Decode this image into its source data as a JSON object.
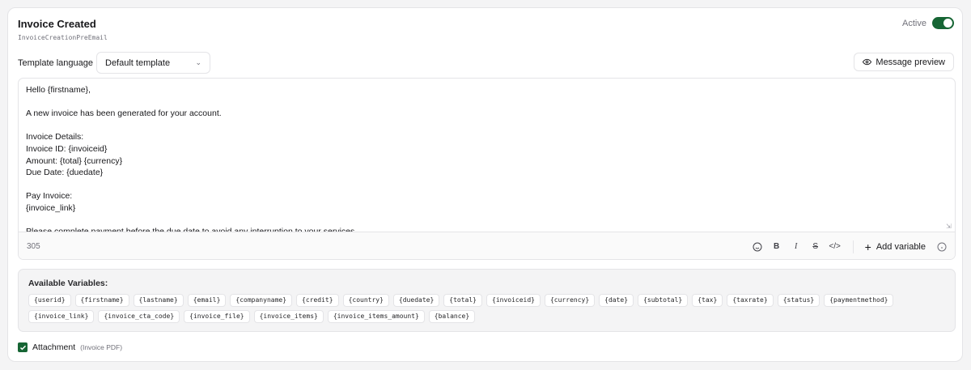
{
  "header": {
    "title": "Invoice Created",
    "template_key": "InvoiceCreationPreEmail",
    "active_label": "Active",
    "active": true
  },
  "template_language": {
    "label": "Template language",
    "selected": "Default template"
  },
  "preview_button": {
    "label": "Message preview",
    "icon": "eye-icon"
  },
  "editor": {
    "body": "Hello {firstname},\n\nA new invoice has been generated for your account.\n\nInvoice Details:\nInvoice ID: {invoiceid}\nAmount: {total} {currency}\nDue Date: {duedate}\n\nPay Invoice:\n{invoice_link}\n\nPlease complete payment before the due date to avoid any interruption to your services.",
    "char_count": "305",
    "tools": {
      "emoji": "smile-icon",
      "bold": "B",
      "italic": "I",
      "strike": "S",
      "code": "</>"
    },
    "add_variable_label": "Add variable"
  },
  "variables": {
    "title": "Available Variables:",
    "items": [
      "{userid}",
      "{firstname}",
      "{lastname}",
      "{email}",
      "{companyname}",
      "{credit}",
      "{country}",
      "{duedate}",
      "{total}",
      "{invoiceid}",
      "{currency}",
      "{date}",
      "{subtotal}",
      "{tax}",
      "{taxrate}",
      "{status}",
      "{paymentmethod}",
      "{invoice_link}",
      "{invoice_cta_code}",
      "{invoice_file}",
      "{invoice_items}",
      "{invoice_items_amount}",
      "{balance}"
    ]
  },
  "attachment": {
    "label": "Attachment",
    "hint": "(Invoice PDF)",
    "checked": true
  },
  "colors": {
    "accent": "#166534",
    "border": "#e4e4e7",
    "muted": "#71717a"
  }
}
